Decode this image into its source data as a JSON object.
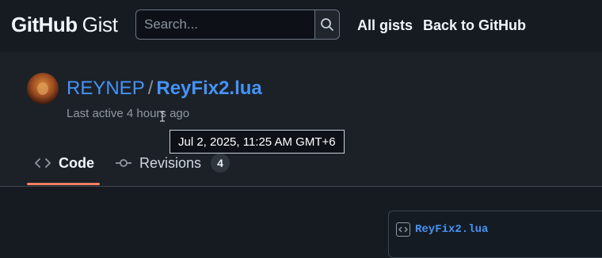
{
  "header": {
    "logo_brand": "GitHub",
    "logo_product": "Gist",
    "search_placeholder": "Search...",
    "nav": [
      "All gists",
      "Back to GitHub"
    ]
  },
  "gist": {
    "owner": "REYNEP",
    "separator": "/",
    "name": "ReyFix2.lua",
    "last_active": "Last active 4 hours ago",
    "tooltip": "Jul 2, 2025, 11:25 AM GMT+6"
  },
  "tabs": {
    "code_label": "Code",
    "revisions_label": "Revisions",
    "revisions_count": "4"
  },
  "file": {
    "name": "ReyFix2.lua"
  },
  "colors": {
    "accent_link": "#4493f8",
    "tab_underline": "#f78166",
    "background": "#161b22"
  }
}
